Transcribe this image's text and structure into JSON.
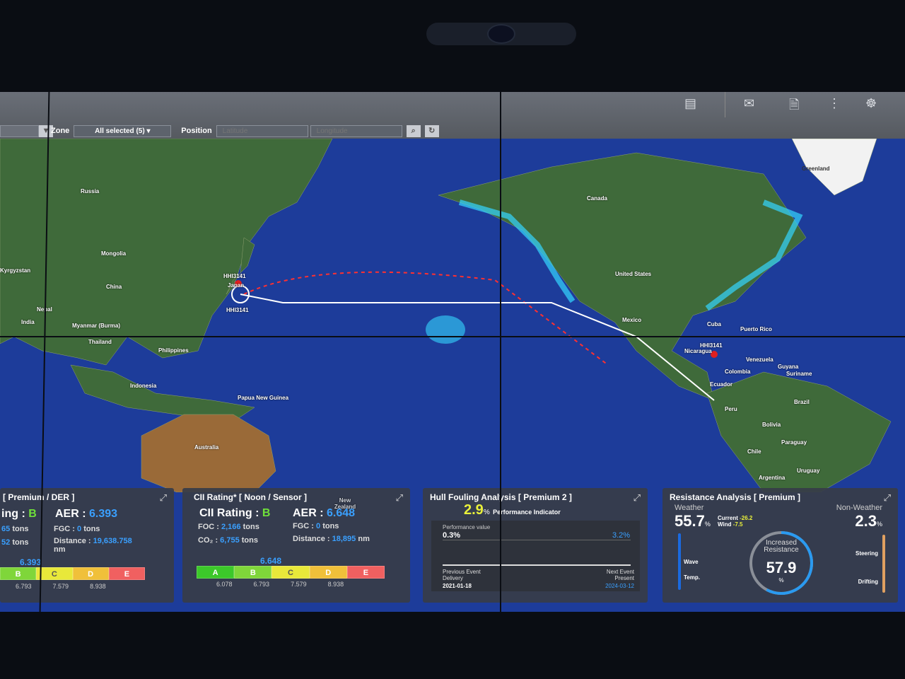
{
  "toolbar": {
    "zone_label": "Zone",
    "zone_value": "All selected (5)",
    "position_label": "Position",
    "latitude_placeholder": "Latitude",
    "longitude_placeholder": "Longitude"
  },
  "header_icons": [
    "dashboard-icon",
    "mail-icon",
    "document-icon",
    "traffic-light-icon",
    "ship-wheel-icon"
  ],
  "map": {
    "vessel_id": "HHI3141",
    "labels": [
      "Russia",
      "Mongolia",
      "China",
      "Kyrgyzstan",
      "Nepal",
      "India",
      "Myanmar (Burma)",
      "Thailand",
      "Philippines",
      "Indonesia",
      "Papua New Guinea",
      "Australia",
      "Japan",
      "New Zealand",
      "Canada",
      "United States",
      "Mexico",
      "Cuba",
      "Puerto Rico",
      "Nicaragua",
      "Venezuela",
      "Guyana",
      "Suriname",
      "Colombia",
      "Ecuador",
      "Peru",
      "Brazil",
      "Bolivia",
      "Paraguay",
      "Chile",
      "Argentina",
      "Uruguay",
      "Greenland"
    ]
  },
  "panel_der": {
    "title": "[ Premium / DER ]",
    "rating_label": "ing : ",
    "rating": "B",
    "aer_label": "AER : ",
    "aer": "6.393",
    "foc_value": "65",
    "co2_value": "52",
    "unit_tons": "tons",
    "fgc_label": "FGC : ",
    "fgc": "0",
    "distance_label": "Distance : ",
    "distance": "19,638.758",
    "distance_unit": "nm",
    "marker": "6.393",
    "grades": [
      "B",
      "C",
      "D",
      "E"
    ],
    "ticks": [
      "6.793",
      "7.579",
      "8.938"
    ]
  },
  "panel_cii": {
    "title": "CII Rating* [ Noon / Sensor ]",
    "rating_label": "CII Rating : ",
    "rating": "B",
    "aer_label": "AER : ",
    "aer": "6.648",
    "foc_label": "FOC : ",
    "foc": "2,166",
    "co2_label": "CO₂ : ",
    "co2": "6,755",
    "unit_tons": "tons",
    "fgc_label": "FGC : ",
    "fgc": "0",
    "distance_label": "Distance : ",
    "distance": "18,895",
    "distance_unit": "nm",
    "marker": "6.648",
    "grades": [
      "A",
      "B",
      "C",
      "D",
      "E"
    ],
    "ticks": [
      "6.078",
      "6.793",
      "7.579",
      "8.938"
    ]
  },
  "panel_hull": {
    "title": "Hull Fouling Analysis [ Premium 2 ]",
    "indicator": "2.9",
    "indicator_unit": "%",
    "indicator_label": "Performance Indicator",
    "perf_label": "Performance value",
    "start_value": "0.3%",
    "end_value": "3.2%",
    "prev_label": "Previous Event",
    "prev_event": "Delivery",
    "prev_date": "2021-01-18",
    "next_label": "Next Event",
    "next_event": "Present",
    "next_date": "2024-03-12"
  },
  "panel_resist": {
    "title": "Resistance Analysis [ Premium ]",
    "weather_label": "Weather",
    "weather": "55.7",
    "pct": "%",
    "current_label": "Current",
    "current": "-26.2",
    "wind_label": "Wind",
    "wind": "-7.5",
    "nonweather_label": "Non-Weather",
    "nonweather": "2.3",
    "wave_label": "Wave",
    "temp_label": "Temp.",
    "steering_label": "Steering",
    "drifting_label": "Drifting",
    "center_label": "Increased Resistance",
    "center_value": "57.9"
  },
  "colors": {
    "ocean": "#1d3c9a",
    "grade_a": "#3cc82a",
    "grade_b": "#7fd63a",
    "grade_c": "#e8e83a",
    "grade_d": "#f0c03a",
    "grade_e": "#f06060",
    "accent": "#3aa0ff"
  }
}
